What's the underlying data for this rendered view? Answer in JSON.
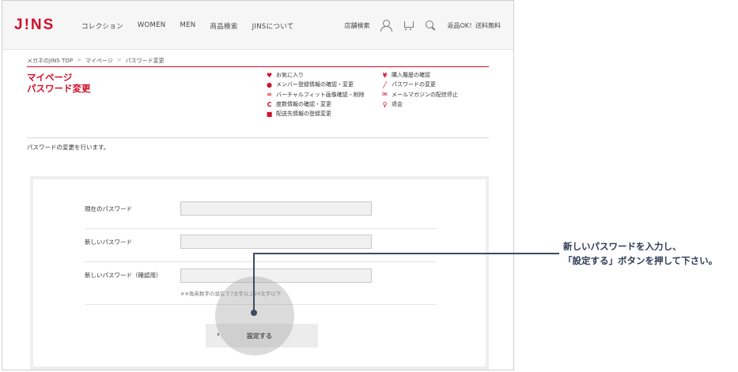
{
  "header": {
    "logo": "J!NS",
    "nav": [
      "コレクション",
      "WOMEN",
      "MEN",
      "商品検索",
      "JINSについて"
    ],
    "store_search": "店舗検索",
    "shipping_note": "返品OK！送料無料"
  },
  "breadcrumb": [
    "メガネのJINS TOP",
    "マイページ",
    "パスワード変更"
  ],
  "breadcrumb_sep": ">",
  "page_title": {
    "line1": "マイページ",
    "line2": "パスワード変更"
  },
  "menu": {
    "col1": [
      {
        "icon": "heart-icon",
        "glyph": "♥",
        "label": "お気に入り"
      },
      {
        "icon": "person-icon",
        "glyph": "●",
        "label": "メンバー登録情報の確認・変更"
      },
      {
        "icon": "glasses-icon",
        "glyph": "∞",
        "label": "バーチャルフィット画像確認・削除"
      },
      {
        "icon": "c-icon",
        "glyph": "C",
        "label": "度数情報の確認・変更"
      },
      {
        "icon": "truck-icon",
        "glyph": "■",
        "label": "配送先情報の登録変更"
      }
    ],
    "col2": [
      {
        "icon": "yen-icon",
        "glyph": "¥",
        "label": "購入履歴の確認"
      },
      {
        "icon": "pen-icon",
        "glyph": "╱",
        "label": "パスワードの変更"
      },
      {
        "icon": "mail-icon",
        "glyph": "✉",
        "label": "メールマガジンの配信停止"
      },
      {
        "icon": "key-icon",
        "glyph": "♀",
        "label": "退会"
      }
    ]
  },
  "intro": "パスワードの変更を行います。",
  "form": {
    "current_password_label": "現在のパスワード",
    "new_password_label": "新しいパスワード",
    "confirm_password_label": "新しいパスワード（確認用）",
    "hint": "※※角英数字の混在で7文字以上24文字以下",
    "submit_label": "設定する",
    "submit_chevron": "›"
  },
  "callout": {
    "line1": "新しいパスワードを入力し、",
    "line2": "「設定する」ボタンを押して下さい。"
  },
  "colors": {
    "brand_red": "#d0102a",
    "callout_navy": "#2e3c56"
  }
}
